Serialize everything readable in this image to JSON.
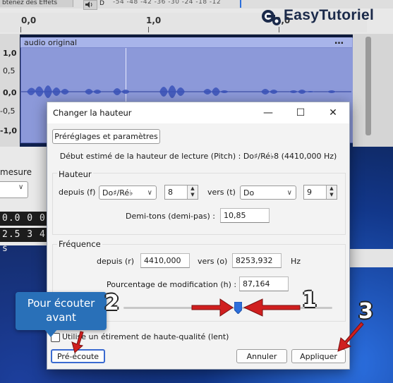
{
  "background_app": {
    "effects_tab": "btenez des Effets",
    "meter_letter": "D",
    "meter_scale": "-54  -48  -42  -36  -30  -24  -18  -12",
    "ruler_labels": [
      "0,0",
      "1,0",
      "2,0"
    ],
    "track_name": "audio original",
    "track_menu": "…",
    "amplitude_labels": [
      "1,0",
      "0,5",
      "0,0",
      "-0,5",
      "-1,0"
    ],
    "mesure_label": "mesure",
    "time_values": [
      "0.0 0 0 s",
      "2.5 3 4 s"
    ]
  },
  "logo": {
    "text": "EasyTutoriel"
  },
  "dialog": {
    "title": "Changer la hauteur",
    "controls": {
      "minimize": "—",
      "maximize": "☐",
      "close": "✕"
    },
    "presets_button": "Préréglages et paramètres",
    "pitch_estimate": "Début estimé de la hauteur de lecture (Pitch) : Do♯/Ré♭8 (4410,000 Hz)",
    "pitch_group": {
      "title": "Hauteur",
      "from_label": "depuis (f)",
      "from_note": "Do♯/Ré♭",
      "from_octave": "8",
      "to_label": "vers (t)",
      "to_note": "Do",
      "to_octave": "9",
      "semitones_label": "Demi-tons (demi-pas) :",
      "semitones_value": "10,85"
    },
    "frequency_group": {
      "title": "Fréquence",
      "from_label": "depuis (r)",
      "from_value": "4410,000",
      "to_label": "vers (o)",
      "to_value": "8253,932",
      "unit": "Hz",
      "percent_label": "Pourcentage de modification (h) :",
      "percent_value": "87,164",
      "slider_level": 0.55
    },
    "hq_stretch_label": "Utilise un étirement de haute-qualité (lent)",
    "hq_stretch_checked": false,
    "preview_button": "Pré-écoute",
    "cancel_button": "Annuler",
    "apply_button": "Appliquer"
  },
  "annotations": {
    "tooltip_line1": "Pour écouter",
    "tooltip_line2": "avant",
    "numbers": [
      "1",
      "2",
      "3"
    ],
    "arrow_color": "#d01f1f"
  }
}
